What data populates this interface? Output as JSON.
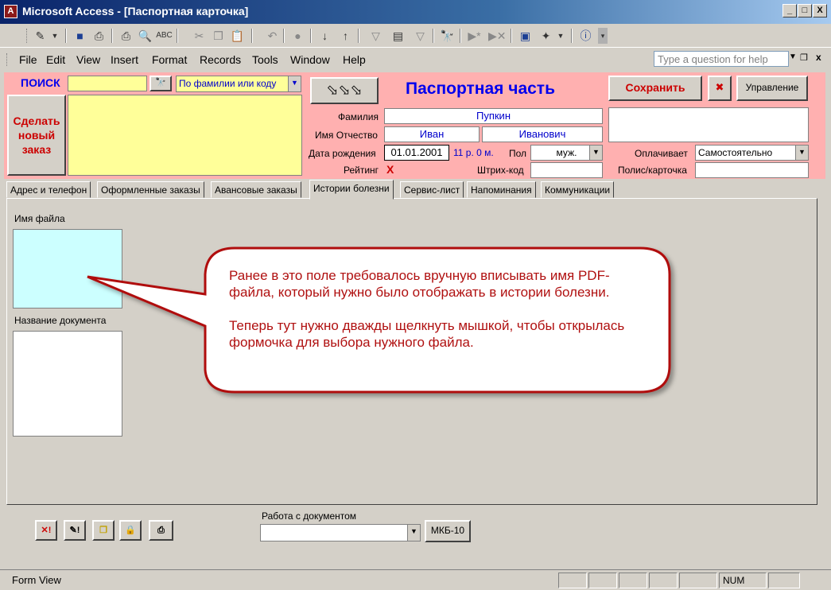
{
  "window": {
    "title": "Microsoft Access - [Паспортная карточка]",
    "minimize": "_",
    "maximize": "□",
    "close": "X"
  },
  "menu": {
    "items": [
      "File",
      "Edit",
      "View",
      "Insert",
      "Format",
      "Records",
      "Tools",
      "Window",
      "Help"
    ],
    "ask_placeholder": "Type a question for help"
  },
  "search": {
    "label": "ПОИСК",
    "value": "",
    "mode": "По фамилии или коду"
  },
  "new_order_button": "Сделать новый заказ",
  "header_title": "Паспортная часть",
  "fields": {
    "surname_label": "Фамилия",
    "surname": "Пупкин",
    "name_label": "Имя Отчество",
    "first_name": "Иван",
    "patronymic": "Иванович",
    "dob_label": "Дата рождения",
    "dob": "01.01.2001",
    "age": "11 р. 0 м.",
    "sex_label": "Пол",
    "sex": "муж.",
    "rating_label": "Рейтинг",
    "rating": "X",
    "barcode_label": "Штрих-код",
    "barcode": "",
    "payer_label": "Оплачивает",
    "payer": "Самостоятельно",
    "policy_label": "Полис/карточка",
    "policy": ""
  },
  "buttons": {
    "save": "Сохранить",
    "manage": "Управление",
    "delete_icon": "✖"
  },
  "tabs": [
    "Адрес и телефон",
    "Оформленные заказы",
    "Авансовые заказы",
    "Истории болезни",
    "Сервис-лист",
    "Напоминания",
    "Коммуникации"
  ],
  "tab_page": {
    "filename_label": "Имя файла",
    "docname_label": "Название документа"
  },
  "callout": {
    "p1": "Ранее в это поле требовалось вручную вписывать имя PDF-файла, который нужно было отображать в истории болезни.",
    "p2": "Теперь тут нужно дважды щелкнуть мышкой, чтобы открылась формочка для выбора нужного файла."
  },
  "document_work": {
    "label": "Работа с документом",
    "value": "",
    "mkb_button": "МКБ-10"
  },
  "status": {
    "mode": "Form View",
    "num": "NUM"
  },
  "colors": {
    "header_bg": "#ffb0b0",
    "note_bg": "#ffff99",
    "filename_bg": "#ccffff",
    "accent_red": "#cc0000",
    "accent_blue": "#0000ee"
  }
}
